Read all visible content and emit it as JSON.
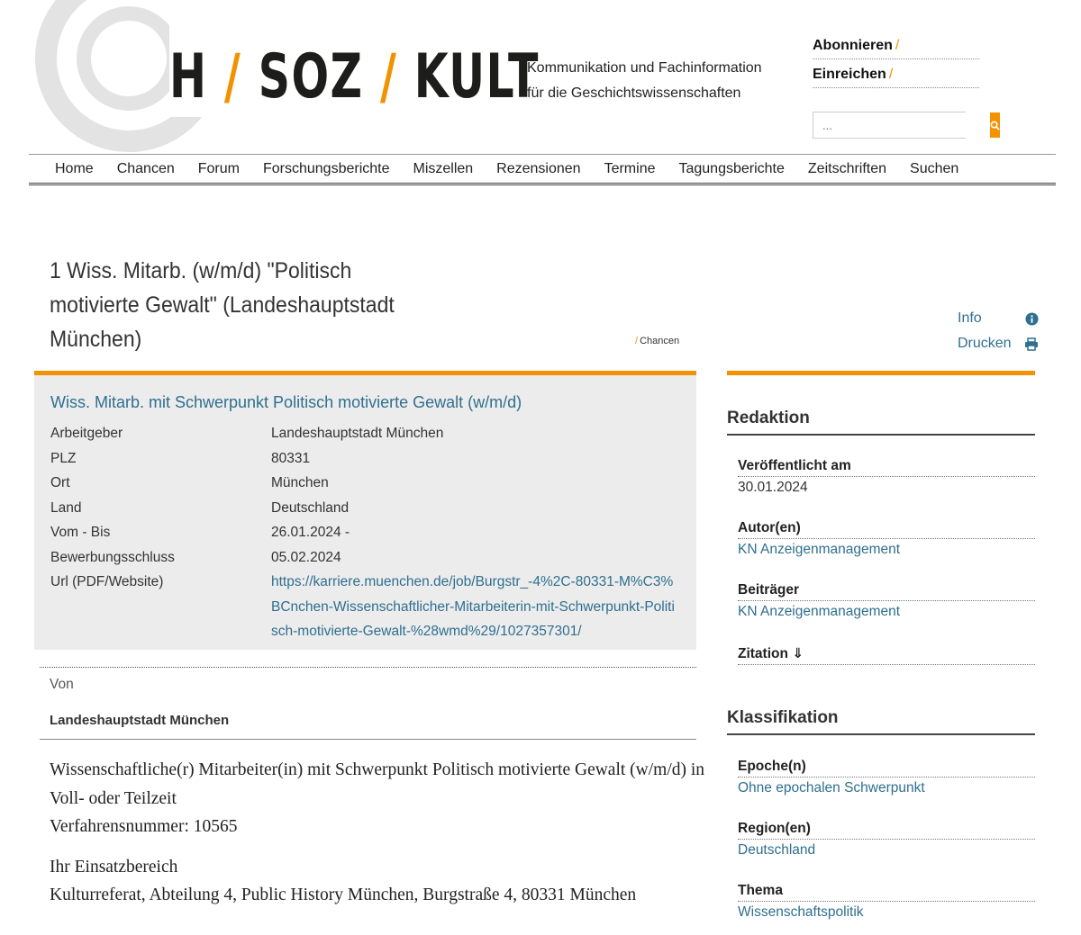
{
  "header": {
    "logo": {
      "h": "H",
      "soz": "SOZ",
      "kult": "KULT",
      "slash": "/"
    },
    "tagline_line1": "Kommunikation und Fachinformation",
    "tagline_line2": "für die Geschichtswissenschaften",
    "links": [
      {
        "label": "Abonnieren",
        "suffix": "/"
      },
      {
        "label": "Einreichen",
        "suffix": "/"
      }
    ],
    "search": {
      "placeholder": "..."
    }
  },
  "nav": [
    "Home",
    "Chancen",
    "Forum",
    "Forschungsberichte",
    "Miszellen",
    "Rezensionen",
    "Termine",
    "Tagungsberichte",
    "Zeitschriften",
    "Suchen"
  ],
  "page": {
    "title": "1 Wiss. Mitarb. (w/m/d) \"Politisch motivierte Gewalt\" (Landeshauptstadt München)",
    "breadcrumb_slash": "/",
    "breadcrumb": "Chancen",
    "tools": [
      {
        "label": "Info",
        "icon": "info-icon"
      },
      {
        "label": "Drucken",
        "icon": "print-icon"
      }
    ]
  },
  "job": {
    "title": "Wiss. Mitarb. mit Schwerpunkt Politisch motivierte Gewalt (w/m/d)",
    "rows": [
      {
        "label": "Arbeitgeber",
        "value": "Landeshauptstadt München"
      },
      {
        "label": "PLZ",
        "value": "80331"
      },
      {
        "label": "Ort",
        "value": "München"
      },
      {
        "label": "Land",
        "value": "Deutschland"
      },
      {
        "label": "Vom - Bis",
        "value": "26.01.2024 -"
      },
      {
        "label": "Bewerbungsschluss",
        "value": "05.02.2024"
      }
    ],
    "url_label": "Url (PDF/Website)",
    "url": "https://karriere.muenchen.de/job/Burgstr_-4%2C-80331-M%C3%BCnchen-Wissenschaftlicher-Mitarbeiterin-mit-Schwerpunkt-Politisch-motivierte-Gewalt-%28wmd%29/1027357301/"
  },
  "von": {
    "label": "Von",
    "name": "Landeshauptstadt München"
  },
  "body": {
    "p1_line1": "Wissenschaftliche(r) Mitarbeiter(in) mit Schwerpunkt Politisch motivierte Gewalt (w/m/d) in Voll- oder Teilzeit",
    "p1_line2": "Verfahrensnummer: 10565",
    "p2_line1": "Ihr Einsatzbereich",
    "p2_line2": "Kulturreferat, Abteilung 4, Public History München, Burgstraße 4, 80331 München"
  },
  "sidebar": {
    "redaktion": {
      "heading": "Redaktion",
      "published_label": "Veröffentlicht am",
      "published_value": "30.01.2024",
      "author_label": "Autor(en)",
      "author_value": "KN Anzeigenmanagement",
      "contrib_label": "Beiträger",
      "contrib_value": "KN Anzeigenmanagement",
      "citation_label": "Zitation ⇓"
    },
    "klassifikation": {
      "heading": "Klassifikation",
      "epoche_label": "Epoche(n)",
      "epoche_value": "Ohne epochalen Schwerpunkt",
      "region_label": "Region(en)",
      "region_value": "Deutschland",
      "thema_label": "Thema",
      "thema_value": "Wissenschaftspolitik"
    }
  },
  "colors": {
    "accent": "#f39200",
    "link": "#2f6f8f",
    "box_bg": "#ececec"
  }
}
